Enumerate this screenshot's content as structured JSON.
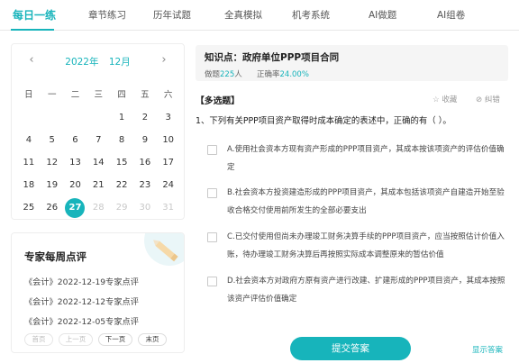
{
  "tabs": [
    {
      "label": "每日一练",
      "active": true
    },
    {
      "label": "章节练习",
      "active": false
    },
    {
      "label": "历年试题",
      "active": false
    },
    {
      "label": "全真模拟",
      "active": false
    },
    {
      "label": "机考系统",
      "active": false
    },
    {
      "label": "AI做题",
      "active": false
    },
    {
      "label": "AI组卷",
      "active": false
    }
  ],
  "calendar": {
    "year": "2022年",
    "month": "12月",
    "weekdays": [
      "日",
      "一",
      "二",
      "三",
      "四",
      "五",
      "六"
    ],
    "weeks": [
      [
        "",
        "",
        "",
        "",
        "1",
        "2",
        "3"
      ],
      [
        "4",
        "5",
        "6",
        "7",
        "8",
        "9",
        "10"
      ],
      [
        "11",
        "12",
        "13",
        "14",
        "15",
        "16",
        "17"
      ],
      [
        "18",
        "19",
        "20",
        "21",
        "22",
        "23",
        "24"
      ],
      [
        "25",
        "26",
        "27",
        "28",
        "29",
        "30",
        "31"
      ]
    ],
    "selected_day": "27"
  },
  "expert": {
    "title": "专家每周点评",
    "items": [
      "《会计》2022-12-19专家点评",
      "《会计》2022-12-12专家点评",
      "《会计》2022-12-05专家点评"
    ],
    "pager": {
      "first": "首页",
      "prev": "上一页",
      "next": "下一页",
      "last": "末页"
    }
  },
  "knowledge": {
    "title": "知识点：政府单位PPP项目合同",
    "done_label": "做题",
    "done_count": "225",
    "done_unit": "人",
    "accuracy_label": "正确率",
    "accuracy_value": "24.00%"
  },
  "question": {
    "type": "【多选题】",
    "favorite": "收藏",
    "report_error": "纠错",
    "stem": "1、下列有关PPP项目资产取得时成本确定的表述中，正确的有（   ）。",
    "options": [
      "A.使用社会资本方现有资产形成的PPP项目资产，其成本按该项资产的评估价值确定",
      "B.社会资本方投资建造形成的PPP项目资产，其成本包括该项资产自建造开始至验收合格交付使用前所发生的全部必要支出",
      "C.已交付使用但尚未办理竣工财务决算手续的PPP项目资产，应当按照估计价值入账，待办理竣工财务决算后再按照实际成本调整原来的暂估价值",
      "D.社会资本方对政府方原有资产进行改建、扩建形成的PPP项目资产，其成本按照该资产评估价值确定"
    ]
  },
  "actions": {
    "submit": "提交答案",
    "show_answer": "显示答案"
  },
  "colors": {
    "accent": "#17b4bb"
  }
}
